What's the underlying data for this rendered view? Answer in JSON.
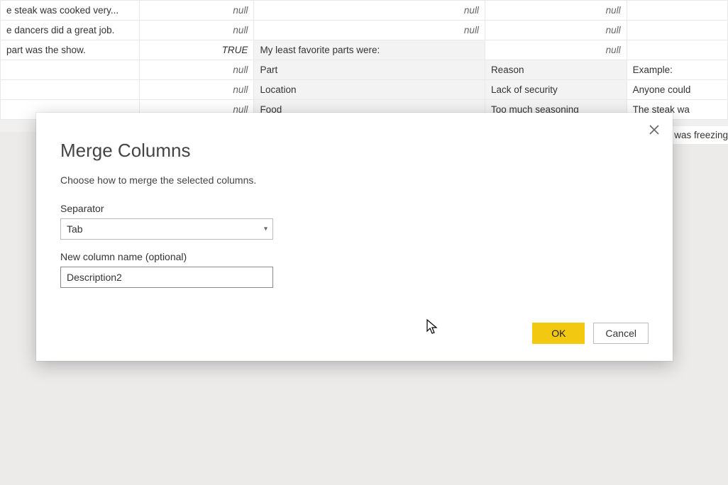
{
  "grid": {
    "rows": [
      {
        "a": "e steak was cooked very...",
        "b": "null",
        "b_class": "null-cell",
        "c": "null",
        "c_class": "null-cell",
        "d": "null",
        "d_class": "null-cell",
        "e": ""
      },
      {
        "a": "e dancers did a great job.",
        "b": "null",
        "b_class": "null-cell",
        "c": "null",
        "c_class": "null-cell",
        "d": "null",
        "d_class": "null-cell",
        "e": ""
      },
      {
        "a": " part was the show.",
        "b": "TRUE",
        "b_class": "true-cell",
        "c": "My least favorite parts were:",
        "c_class": "shaded",
        "d": "null",
        "d_class": "null-cell",
        "e": ""
      },
      {
        "a": "",
        "b": "null",
        "b_class": "null-cell",
        "c": "Part",
        "c_class": "shaded",
        "d": "Reason",
        "d_class": "shaded",
        "e": "Example:"
      },
      {
        "a": "",
        "b": "null",
        "b_class": "null-cell",
        "c": "Location",
        "c_class": "shaded",
        "d": "Lack of security",
        "d_class": "shaded",
        "e": "Anyone could"
      },
      {
        "a": "",
        "b": "null",
        "b_class": "null-cell",
        "c": "Food",
        "c_class": "shaded",
        "d": "Too much seasoning",
        "d_class": "shaded",
        "e": "The steak wa"
      }
    ],
    "trailing_text": "was freezing"
  },
  "dialog": {
    "title": "Merge Columns",
    "subtitle": "Choose how to merge the selected columns.",
    "separator_label": "Separator",
    "separator_value": "Tab",
    "column_name_label": "New column name (optional)",
    "column_name_value": "Description2",
    "ok_label": "OK",
    "cancel_label": "Cancel"
  }
}
